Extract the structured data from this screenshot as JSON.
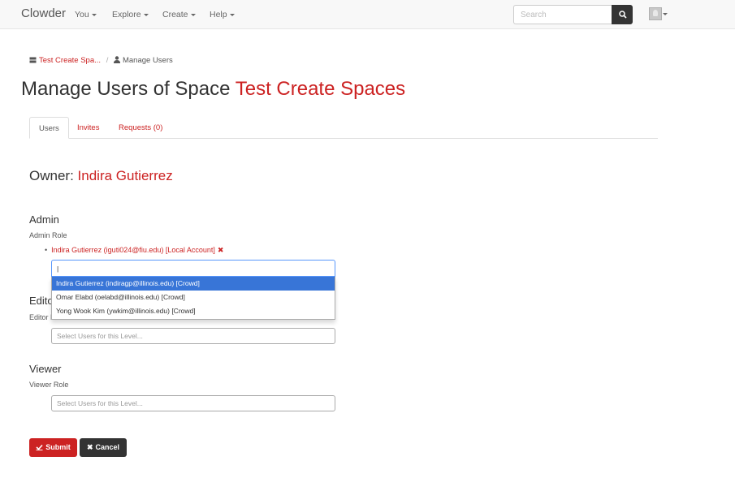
{
  "navbar": {
    "brand": "Clowder",
    "menus": [
      "You",
      "Explore",
      "Create",
      "Help"
    ],
    "search_placeholder": "Search"
  },
  "breadcrumb": {
    "space": "Test Create Spa...",
    "separator": "/",
    "current": "Manage Users"
  },
  "page": {
    "title_prefix": "Manage Users of Space",
    "title_space": "Test Create Spaces"
  },
  "tabs": [
    {
      "label": "Users",
      "active": true
    },
    {
      "label": "Invites",
      "active": false
    },
    {
      "label": "Requests (0)",
      "active": false
    }
  ],
  "owner": {
    "label": "Owner:",
    "name": "Indira Gutierrez"
  },
  "admin": {
    "title": "Admin",
    "role": "Admin Role",
    "users": [
      "Indira Gutierrez (iguti024@fiu.edu) [Local Account]"
    ],
    "input_value": "|",
    "dropdown": [
      "Indira Gutierrez (indiragp@illinois.edu) [Crowd]",
      "Omar Elabd (oelabd@illinois.edu) [Crowd]",
      "Yong Wook Kim (ywkim@illinois.edu) [Crowd]"
    ]
  },
  "editor": {
    "title": "Editor",
    "role": "Editor Role",
    "placeholder": "Select Users for this Level..."
  },
  "viewer": {
    "title": "Viewer",
    "role": "Viewer Role",
    "placeholder": "Select Users for this Level..."
  },
  "buttons": {
    "submit": "Submit",
    "cancel": "Cancel"
  },
  "colors": {
    "accent": "#cc2222",
    "dark": "#333333",
    "highlight": "#3875d7"
  }
}
